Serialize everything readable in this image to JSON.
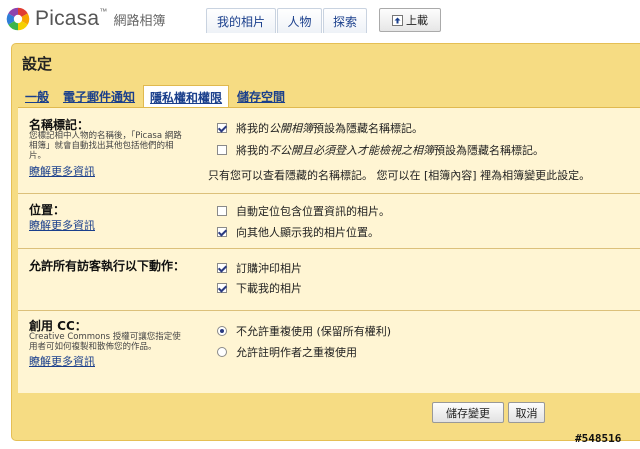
{
  "header": {
    "brand": "Picasa",
    "brand_tm": "™",
    "brand_sub": "網路相簿",
    "nav": [
      "我的相片",
      "人物",
      "探索"
    ],
    "upload_label": "上載"
  },
  "settings": {
    "title": "設定",
    "tabs": [
      "一般",
      "電子郵件通知",
      "隱私權和權限",
      "儲存空間"
    ],
    "active_tab": "隱私權和權限",
    "name_tags": {
      "title": "名稱標記：",
      "description": "您標記相中人物的名稱後，「Picasa 網路相簿」就會自動找出其他包括他們的相片。",
      "learn_more": "瞭解更多資訊",
      "option1": {
        "pre": "將我的",
        "em": "公開相簿",
        "post": "預設為隱藏名稱標記。",
        "checked": true
      },
      "option2": {
        "pre": "將我的",
        "em": "不公開且必須登入才能檢視之相簿",
        "post": "預設為隱藏名稱標記。",
        "checked": false
      },
      "note": "只有您可以查看隱藏的名稱標記。 您可以在 [相簿內容] 裡為相簿變更此設定。"
    },
    "location": {
      "title": "位置：",
      "learn_more": "瞭解更多資訊",
      "option1": {
        "label": "自動定位包含位置資訊的相片。",
        "checked": false
      },
      "option2": {
        "label": "向其他人顯示我的相片位置。",
        "checked": true
      }
    },
    "visitors": {
      "title": "允許所有訪客執行以下動作：",
      "option1": {
        "label": "訂購沖印相片",
        "checked": true
      },
      "option2": {
        "label": "下載我的相片",
        "checked": true
      }
    },
    "cc": {
      "title": "創用 CC：",
      "description": "Creative Commons 授權可讓您指定使用者可如何複製和散佈您的作品。",
      "learn_more": "瞭解更多資訊",
      "option1": {
        "label": "不允許重複使用 (保留所有權利)",
        "selected": true
      },
      "option2": {
        "label": "允許註明作者之重複使用",
        "selected": false
      }
    },
    "save_label": "儲存變更",
    "cancel_label": "取消"
  },
  "watermark": "#548516",
  "colors": {
    "panel": "#f6dc83",
    "content": "#fff5d3",
    "link": "#1a3f8c"
  }
}
